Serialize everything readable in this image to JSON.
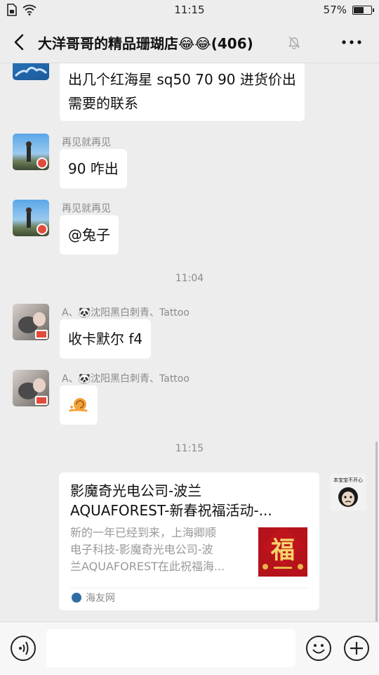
{
  "status": {
    "time": "11:15",
    "battery": "57%",
    "battery_level": 0.57
  },
  "header": {
    "title": "大洋哥哥的精品珊瑚店😂😂(406)"
  },
  "messages": [
    {
      "text": "出几个红海星 sq50 70 90 进货价出",
      "text2": "需要的联系"
    },
    {
      "sender": "再见就再见",
      "text": "90 咋出"
    },
    {
      "sender": "再见就再见",
      "text": "@兔子"
    },
    {
      "time": "11:04"
    },
    {
      "sender": "A、🐼沈阳黑白刺青、Tattoo",
      "text": "收卡默尔 f4"
    },
    {
      "sender": "A、🐼沈阳黑白刺青、Tattoo",
      "icon": "snail-sticker-icon"
    },
    {
      "time": "11:15"
    }
  ],
  "link_card": {
    "title_line1": "影魔奇光电公司-波兰",
    "title_line2": "AQUAFOREST-新春祝福活动-...",
    "desc_line1": "新的一年已经到来，上海卿顺",
    "desc_line2": "电子科技-影魔奇光电公司-波",
    "desc_line3": "兰AQUAFOREST在此祝福海...",
    "thumb_char": "福",
    "source": "海友网",
    "sticker_text": "本宝宝不开心"
  },
  "colors": {
    "background": "#ededed",
    "bubble": "#ffffff",
    "badge": "#e24b3b",
    "thumb": "#b5121b"
  }
}
